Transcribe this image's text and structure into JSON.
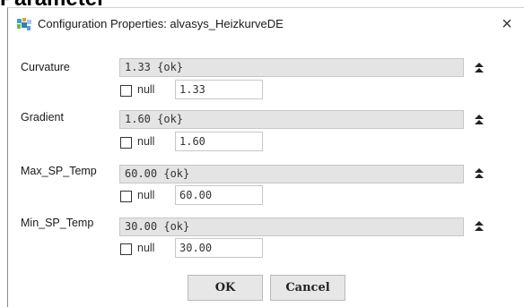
{
  "background": {
    "heading": "Parameter"
  },
  "dialog": {
    "title": "Configuration Properties: alvasys_HeizkurveDE",
    "close_symbol": "×",
    "properties": [
      {
        "label": "Curvature",
        "value": "1.33 {ok}",
        "null_label": "null",
        "null_checked": false,
        "null_value": "1.33"
      },
      {
        "label": "Gradient",
        "value": "1.60 {ok}",
        "null_label": "null",
        "null_checked": false,
        "null_value": "1.60"
      },
      {
        "label": "Max_SP_Temp",
        "value": "60.00 {ok}",
        "null_label": "null",
        "null_checked": false,
        "null_value": "60.00"
      },
      {
        "label": "Min_SP_Temp",
        "value": "30.00 {ok}",
        "null_label": "null",
        "null_checked": false,
        "null_value": "30.00"
      }
    ],
    "buttons": {
      "ok": "OK",
      "cancel": "Cancel"
    }
  },
  "icons": {
    "title": "app-icon",
    "close": "close-icon",
    "expand": "expand-arrows-icon"
  },
  "colors": {
    "field_bg": "#e4e4e4",
    "button_bg": "#e7e7e7",
    "window_bg": "#ffffff"
  }
}
